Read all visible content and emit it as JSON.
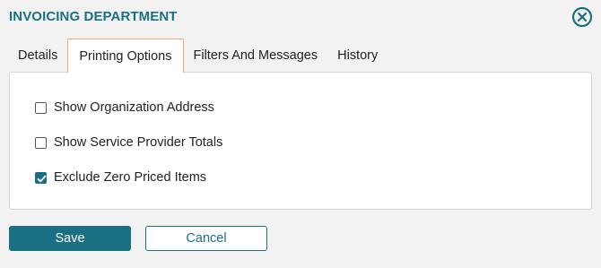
{
  "dialog": {
    "title": "INVOICING DEPARTMENT",
    "close_icon": "close-circle-icon"
  },
  "tabs": [
    {
      "label": "Details",
      "active": false
    },
    {
      "label": "Printing Options",
      "active": true
    },
    {
      "label": "Filters And Messages",
      "active": false
    },
    {
      "label": "History",
      "active": false
    }
  ],
  "options": [
    {
      "label": "Show Organization Address",
      "checked": false
    },
    {
      "label": "Show Service Provider Totals",
      "checked": false
    },
    {
      "label": "Exclude Zero Priced Items",
      "checked": true
    }
  ],
  "buttons": {
    "save_label": "Save",
    "cancel_label": "Cancel"
  },
  "colors": {
    "accent": "#1b6f82",
    "active_tab_border": "#f0a878",
    "background": "#f2f2f2"
  }
}
